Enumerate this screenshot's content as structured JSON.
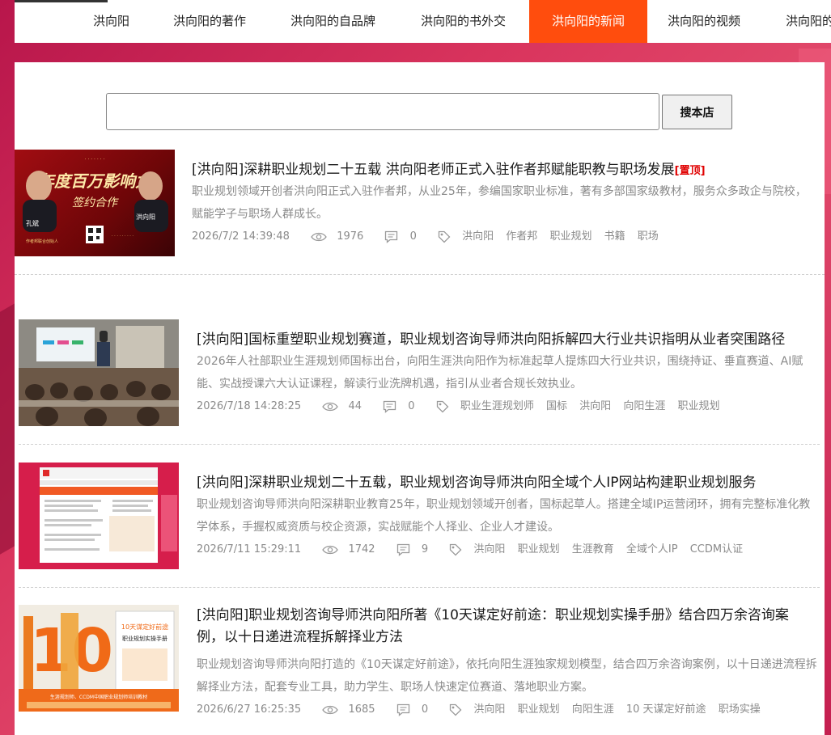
{
  "nav": {
    "items": [
      {
        "label": "洪向阳"
      },
      {
        "label": "洪向阳的著作"
      },
      {
        "label": "洪向阳的自品牌"
      },
      {
        "label": "洪向阳的书外交"
      },
      {
        "label": "洪向阳的新闻"
      },
      {
        "label": "洪向阳的视频"
      },
      {
        "label": "洪向阳的"
      }
    ],
    "active_index": 4
  },
  "search": {
    "placeholder": "",
    "button_label": "搜本店"
  },
  "articles": [
    {
      "title": "[洪向阳]深耕职业规划二十五载 洪向阳老师正式入驻作者邦赋能职教与职场发展",
      "top_tag": "[置顶]",
      "summary": "职业规划领域开创者洪向阳正式入驻作者邦，从业25年，参编国家职业标准，著有多部国家级教材，服务众多政企与院校，赋能学子与职场人群成长。",
      "date": "2026/7/2 14:39:48",
      "views": "1976",
      "comments": "0",
      "tags": [
        "洪向阳",
        "作者邦",
        "职业规划",
        "书籍",
        "职场"
      ],
      "thumb_text": {
        "line1": "年度百万影响力",
        "line2": "签约合作",
        "left_name": "孔斌",
        "right_name": "洪向阳",
        "small": "作者邦联合创始人"
      }
    },
    {
      "title": "[洪向阳]国标重塑职业规划赛道，职业规划咨询导师洪向阳拆解四大行业共识指明从业者突围路径",
      "summary": "2026年人社部职业生涯规划师国标出台，向阳生涯洪向阳作为标准起草人提炼四大行业共识，围绕持证、垂直赛道、AI赋能、实战授课六大认证课程，解读行业洗牌机遇，指引从业者合规长效执业。",
      "date": "2026/7/18 14:28:25",
      "views": "44",
      "comments": "0",
      "tags": [
        "职业生涯规划师",
        "国标",
        "洪向阳",
        "向阳生涯",
        "职业规划"
      ]
    },
    {
      "title": "[洪向阳]深耕职业规划二十五载，职业规划咨询导师洪向阳全域个人IP网站构建职业规划服务",
      "summary": "职业规划咨询导师洪向阳深耕职业教育25年，职业规划领域开创者，国标起草人。搭建全域IP运营闭环，拥有完整标准化教学体系，手握权威资质与校企资源，实战赋能个人择业、企业人才建设。",
      "date": "2026/7/11 15:29:11",
      "views": "1742",
      "comments": "9",
      "tags": [
        "洪向阳",
        "职业规划",
        "生涯教育",
        "全域个人IP",
        "CCDM认证"
      ]
    },
    {
      "title": "[洪向阳]职业规划咨询导师洪向阳所著《10天谋定好前途：职业规划实操手册》结合四万余咨询案例，以十日递进流程拆解择业方法",
      "summary": "职业规划咨询导师洪向阳打造的《10天谋定好前途》，依托向阳生涯独家规划模型，结合四万余咨询案例，以十日递进流程拆解择业方法，配套专业工具，助力学生、职场人快速定位赛道、落地职业方案。",
      "date": "2026/6/27 16:25:35",
      "views": "1685",
      "comments": "0",
      "tags": [
        "洪向阳",
        "职业规划",
        "向阳生涯",
        "10 天谋定好前途",
        "职场实操"
      ],
      "thumb_text": {
        "big": "10",
        "cover": "10天谋定好前途",
        "sub": "职业规划实操手册",
        "band": "生涯规划师、CCDM中国职业规划师培训教材"
      }
    }
  ],
  "colors": {
    "accent": "#ff4d0d",
    "top_tag": "#e00000",
    "meta": "#8a8a8a"
  }
}
